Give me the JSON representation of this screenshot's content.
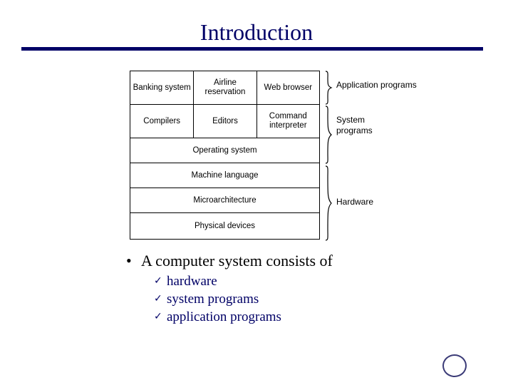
{
  "slide": {
    "title": "Introduction",
    "accent_color": "#000066",
    "background_color": "#ffffff"
  },
  "diagram": {
    "rows": [
      {
        "cells": [
          "Banking\nsystem",
          "Airline\nreservation",
          "Web\nbrowser"
        ]
      },
      {
        "cells": [
          "Compilers",
          "Editors",
          "Command\ninterpreter"
        ]
      },
      {
        "cells": [
          "Operating system"
        ]
      },
      {
        "cells": [
          "Machine language"
        ]
      },
      {
        "cells": [
          "Microarchitecture"
        ]
      },
      {
        "cells": [
          "Physical devices"
        ]
      }
    ],
    "cell_texts": {
      "banking_system": "Banking\nsystem",
      "airline_reservation": "Airline\nreservation",
      "web_browser": "Web\nbrowser",
      "compilers": "Compilers",
      "editors": "Editors",
      "command_interpreter": "Command\ninterpreter",
      "operating_system": "Operating system",
      "machine_language": "Machine language",
      "microarchitecture": "Microarchitecture",
      "physical_devices": "Physical devices"
    },
    "groups": [
      {
        "label": "Application programs",
        "spans_rows": 1
      },
      {
        "label": "System\nprograms",
        "spans_rows": 2
      },
      {
        "label": "Hardware",
        "spans_rows": 3
      }
    ],
    "group_labels": {
      "application_programs": "Application programs",
      "system_programs": "System\nprograms",
      "hardware": "Hardware"
    }
  },
  "bullets": {
    "main": "A computer system consists of",
    "bullet_glyph": "•",
    "check_glyph": "✓",
    "sub_items": [
      "hardware",
      "system programs",
      "application programs"
    ]
  },
  "decoration": {
    "circle_color": "#3b3b77"
  }
}
